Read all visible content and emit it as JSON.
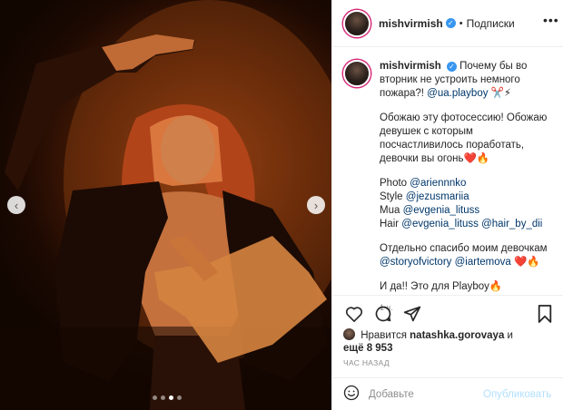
{
  "post": {
    "username": "mishvirmish",
    "separator": "•",
    "follow_label": "Подписки",
    "more_label": "•••"
  },
  "caption": {
    "username": "mishvirmish",
    "line1": "Почему бы во вторник не устроить немного пожара?!",
    "mention_ua": "@ua.playboy",
    "emoji1": "✂️⚡",
    "para2": "Обожаю эту фотосессию! Обожаю девушек с которым посчастливилось поработать, девочки вы огонь❤️🔥",
    "photo_label": "Photo",
    "photo_mention": "@ariennnko",
    "style_label": "Style",
    "style_mention": "@jezusmariia",
    "mua_label": "Mua",
    "mua_mention": "@evgenia_lituss",
    "hair_label": "Hair",
    "hair_mention1": "@evgenia_lituss",
    "hair_mention2": "@hair_by_dii",
    "thanks": "Отдельно спасибо моим девочкам",
    "thanks_mention1": "@storyofvictory",
    "thanks_mention2": "@iartemova",
    "thanks_emoji": "❤️🔥",
    "final": "И да!! Это для Playboy🔥",
    "time": "1 ч."
  },
  "likes": {
    "prefix": "Нравится",
    "user": "natashka.gorovaya",
    "connector": "и",
    "others": "ещё 8 953"
  },
  "timestamp": "ЧАС НАЗАД",
  "comment": {
    "placeholder": "Добавьте",
    "publish_label": "Опубликовать"
  },
  "carousel": {
    "prev_label": "‹",
    "next_label": "›",
    "slides": 4,
    "active_slide": 3
  },
  "colors": {
    "link": "#00376b",
    "verified": "#3897f0",
    "publish_disabled": "#b2dffc",
    "story_ring": "#d62976"
  },
  "icons": [
    "verified-badge-icon",
    "heart-icon",
    "comment-icon",
    "share-icon",
    "bookmark-icon",
    "emoji-icon"
  ]
}
